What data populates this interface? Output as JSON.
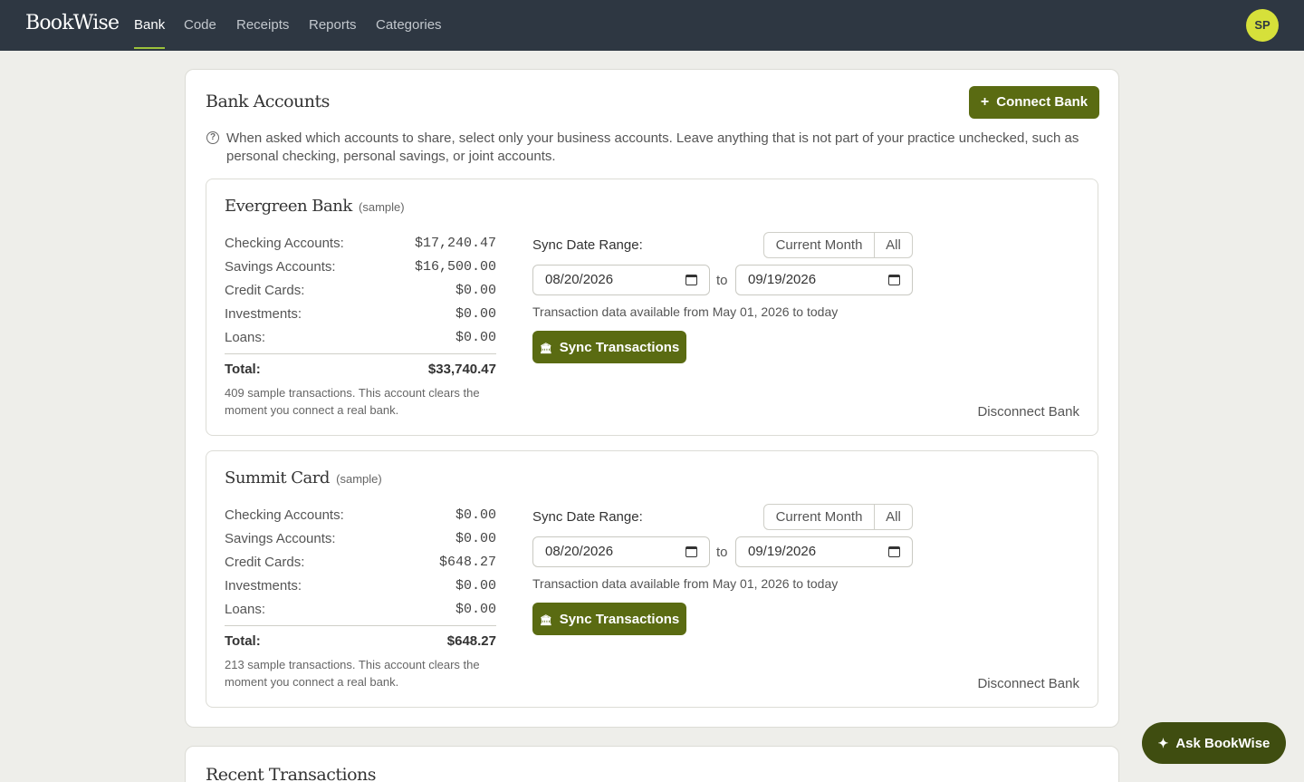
{
  "nav": {
    "logo": "BookWise",
    "links": [
      "Bank",
      "Code",
      "Receipts",
      "Reports",
      "Categories"
    ],
    "active": "Bank",
    "avatar": "SP"
  },
  "bank_accounts": {
    "title": "Bank Accounts",
    "connect_label": "Connect Bank",
    "notice": "When asked which accounts to share, select only your business accounts. Leave anything that is not part of your practice unchecked, such as personal checking, personal savings, or joint accounts."
  },
  "banks": [
    {
      "name": "Evergreen Bank",
      "tag": "(sample)",
      "balances": [
        {
          "label": "Checking Accounts:",
          "value": "$17,240.47"
        },
        {
          "label": "Savings Accounts:",
          "value": "$16,500.00"
        },
        {
          "label": "Credit Cards:",
          "value": "$0.00"
        },
        {
          "label": "Investments:",
          "value": "$0.00"
        },
        {
          "label": "Loans:",
          "value": "$0.00"
        }
      ],
      "total_label": "Total:",
      "total_value": "$33,740.47",
      "note": "409 sample transactions. This account clears the moment you connect a real bank.",
      "sync_label": "Sync Date Range:",
      "range_current": "Current Month",
      "range_all": "All",
      "date_from": "08/20/2026",
      "to_label": "to",
      "date_to": "09/19/2026",
      "availability": "Transaction data available from May 01, 2026 to today",
      "sync_button": "Sync Transactions",
      "disconnect": "Disconnect Bank"
    },
    {
      "name": "Summit Card",
      "tag": "(sample)",
      "balances": [
        {
          "label": "Checking Accounts:",
          "value": "$0.00"
        },
        {
          "label": "Savings Accounts:",
          "value": "$0.00"
        },
        {
          "label": "Credit Cards:",
          "value": "$648.27"
        },
        {
          "label": "Investments:",
          "value": "$0.00"
        },
        {
          "label": "Loans:",
          "value": "$0.00"
        }
      ],
      "total_label": "Total:",
      "total_value": "$648.27",
      "note": "213 sample transactions. This account clears the moment you connect a real bank.",
      "sync_label": "Sync Date Range:",
      "range_current": "Current Month",
      "range_all": "All",
      "date_from": "08/20/2026",
      "to_label": "to",
      "date_to": "09/19/2026",
      "availability": "Transaction data available from May 01, 2026 to today",
      "sync_button": "Sync Transactions",
      "disconnect": "Disconnect Bank"
    }
  ],
  "recent": {
    "title": "Recent Transactions"
  },
  "assistant": {
    "label": "Ask BookWise"
  },
  "colors": {
    "nav_bg": "#2e3742",
    "accent": "#5a6b12",
    "nav_underline": "#9cc23a",
    "avatar_bg": "#d6e03a"
  }
}
